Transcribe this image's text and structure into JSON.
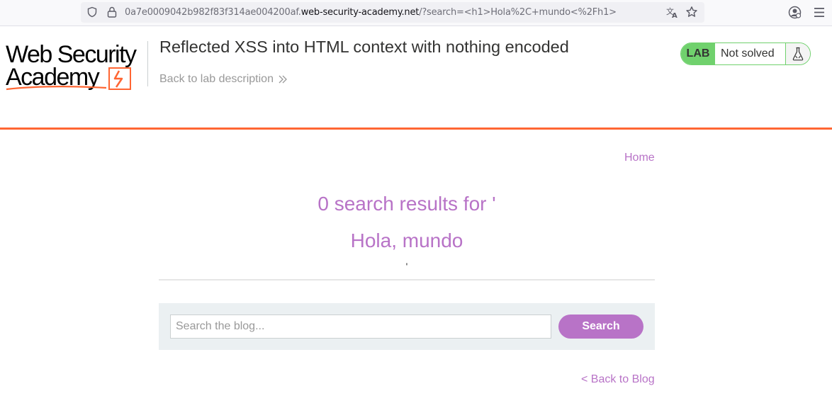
{
  "browser": {
    "url_prefix": "0a7e0009042b982f83f314ae004200af.",
    "url_domain": "web-security-academy.net",
    "url_suffix": "/?search=<h1>Hola%2C+mundo<%2Fh1>",
    "icons": [
      "shield-icon",
      "lock-icon",
      "translate-icon",
      "star-icon",
      "account-icon",
      "menu-icon"
    ]
  },
  "header": {
    "logo_line1": "Web Security",
    "logo_line2": "Academy",
    "lab_title": "Reflected XSS into HTML context with nothing encoded",
    "back_to_description": "Back to lab description",
    "status_badge": "LAB",
    "status_text": "Not solved"
  },
  "nav": {
    "home": "Home"
  },
  "results": {
    "heading": "0 search results for '",
    "reflected_h1": "Hola, mundo",
    "trailing_quote": "'"
  },
  "search": {
    "placeholder": "Search the blog...",
    "value": "",
    "button_label": "Search"
  },
  "footer": {
    "back_to_blog": "< Back to Blog"
  },
  "colors": {
    "accent": "#b873c7",
    "lab_green": "#70d16d",
    "brand_orange": "#ff6633",
    "panel_bg": "#ebf0f2"
  }
}
